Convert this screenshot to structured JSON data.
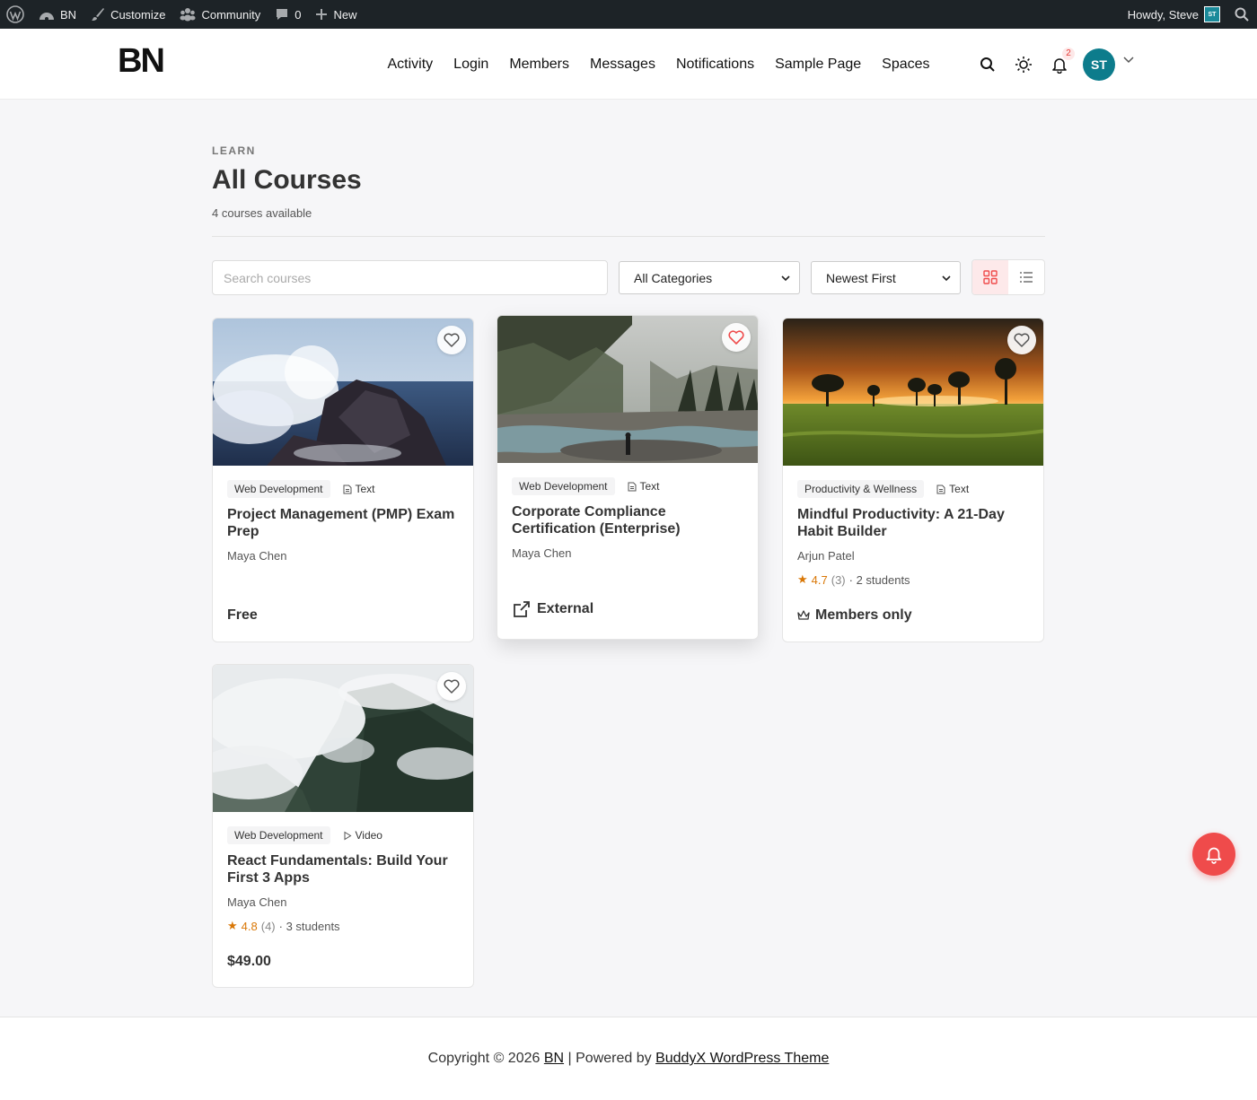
{
  "adminbar": {
    "site": "BN",
    "customize": "Customize",
    "community": "Community",
    "comments_count": "0",
    "new": "New",
    "howdy": "Howdy, Steve",
    "avatar_initials": "ST"
  },
  "header": {
    "logo": "BN",
    "nav": [
      "Activity",
      "Login",
      "Members",
      "Messages",
      "Notifications",
      "Sample Page",
      "Spaces"
    ],
    "notification_count": "2",
    "avatar_initials": "ST"
  },
  "page": {
    "eyebrow": "LEARN",
    "title": "All Courses",
    "subtitle": "4 courses available"
  },
  "filters": {
    "search_placeholder": "Search courses",
    "category": "All Categories",
    "sort": "Newest First"
  },
  "courses": [
    {
      "category": "Web Development",
      "format": "Text",
      "title": "Project Management (PMP) Exam Prep",
      "author": "Maya Chen",
      "price": "Free"
    },
    {
      "category": "Web Development",
      "format": "Text",
      "title": "Corporate Compliance Certification (Enterprise)",
      "author": "Maya Chen",
      "price": "External"
    },
    {
      "category": "Productivity & Wellness",
      "format": "Text",
      "title": "Mindful Productivity: A 21-Day Habit Builder",
      "author": "Arjun Patel",
      "rating": "4.7",
      "rating_count": "(3)",
      "students": "· 2 students",
      "price": "Members only"
    },
    {
      "category": "Web Development",
      "format": "Video",
      "title": "React Fundamentals: Build Your First 3 Apps",
      "author": "Maya Chen",
      "rating": "4.8",
      "rating_count": "(4)",
      "students": "· 3 students",
      "price": "$49.00"
    }
  ],
  "footer": {
    "prefix": "Copyright © 2026",
    "site_link": "BN",
    "separator": "| Powered by",
    "theme_link": "BuddyX WordPress Theme"
  },
  "colors": {
    "accent": "#ef4b4b",
    "avatar": "#0d7c8c",
    "star": "#d97706",
    "adminbar": "#1d2327"
  }
}
